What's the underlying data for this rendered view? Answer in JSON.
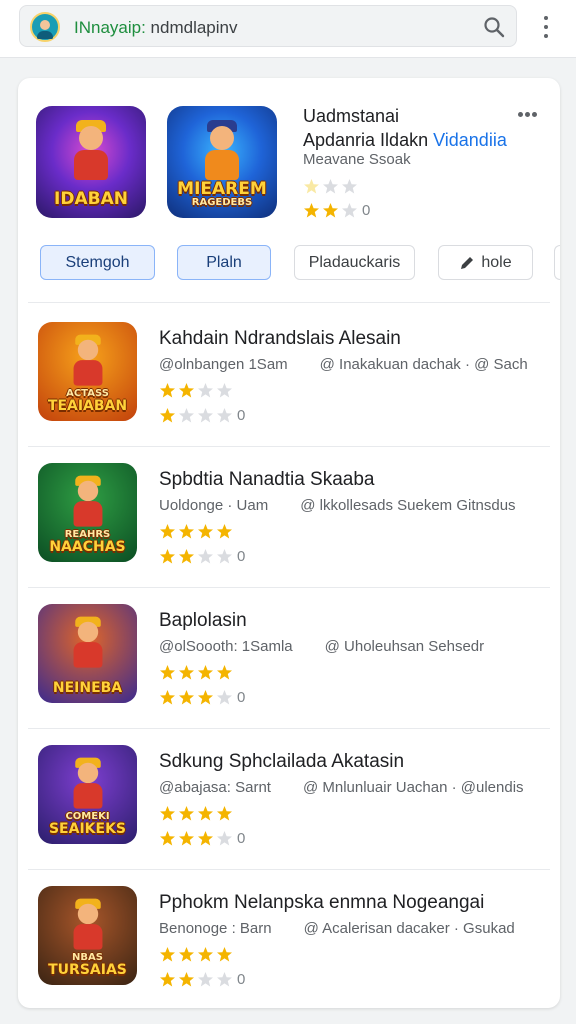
{
  "browser": {
    "url_highlight": "INnayaip:",
    "url_rest": " ndmdlapinv"
  },
  "hero": {
    "icon_a_text": "IDABAN",
    "icon_b_text": "MIEAREM",
    "icon_b_subtext": "RAGEDEBS",
    "title_line1": "Uadmstanai",
    "title_line2_main": "Apdanria Ildakn ",
    "title_line2_accent": "Vidandiia",
    "subtitle": "Meavane Ssoak",
    "rating_top": {
      "on": 0,
      "dim": 1,
      "total": 3
    },
    "rating_bottom": {
      "on": 2,
      "total": 3,
      "count": "0"
    }
  },
  "filters": [
    {
      "label": "Stemgoh",
      "style": "blue"
    },
    {
      "label": "Plaln",
      "style": "blue"
    },
    {
      "label": "Pladauckaris",
      "style": "outline"
    },
    {
      "label": "hole",
      "style": "outline",
      "icon": "pencil-icon"
    }
  ],
  "apps": [
    {
      "title": "Kahdain Ndrandslais Alesain",
      "meta_left": "@olnbangen 1Sam",
      "meta_right": "@ Inakakuan dachak · @ Sach",
      "icon_text": "TEAIABAN",
      "icon_subtext": "ACTASS",
      "rating_top_on": 2,
      "rating_bottom_on": 1,
      "count": "0",
      "palette": [
        "#f7a21b",
        "#c2410c"
      ]
    },
    {
      "title": "Spbdtia Nanadtia Skaaba",
      "meta_left": "Uoldonge · Uam",
      "meta_right": "@ lkkollesads Suekem Gitnsdus",
      "icon_text": "NAACHAS",
      "icon_subtext": "REAHRS",
      "rating_top_on": 4,
      "rating_bottom_on": 2,
      "count": "0",
      "palette": [
        "#2f9e44",
        "#0b4d23"
      ]
    },
    {
      "title": "Baplolasin",
      "meta_left": "@olSoooth: 1Samla",
      "meta_right": "@ Uholeuhsan Sehsedr",
      "icon_text": "NEINEBA",
      "icon_subtext": "",
      "rating_top_on": 4,
      "rating_bottom_on": 3,
      "count": "0",
      "palette": [
        "#e0662a",
        "#3b2a8f"
      ]
    },
    {
      "title": "Sdkung Sphclailada Akatasin",
      "meta_left": "@abajasa: Sarnt",
      "meta_right": "@ Mnlunluair Uachan · @ulendis",
      "icon_text": "SEAIKEKS",
      "icon_subtext": "COMEKI",
      "rating_top_on": 4,
      "rating_bottom_on": 3,
      "count": "0",
      "palette": [
        "#7e3fd1",
        "#2b1e6b"
      ]
    },
    {
      "title": "Pphokm Nelanpska enmna Nogeangai",
      "meta_left": "Benonoge : Barn",
      "meta_right": "@ Acalerisan dacaker · Gsukad",
      "icon_text": "TURSAIAS",
      "icon_subtext": "NBAS",
      "rating_top_on": 4,
      "rating_bottom_on": 2,
      "count": "0",
      "palette": [
        "#a8562a",
        "#3a2413"
      ]
    }
  ]
}
